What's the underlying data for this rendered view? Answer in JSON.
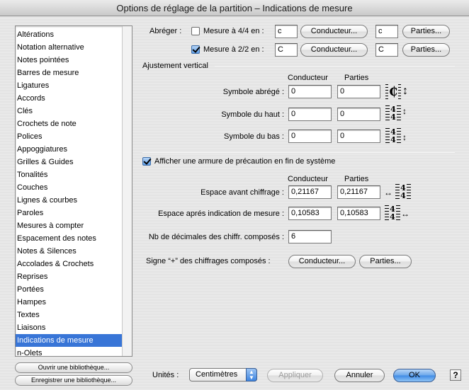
{
  "window": {
    "title": "Options de réglage de la partition – Indications de mesure"
  },
  "sidebar": {
    "items": [
      "Altérations",
      "Notation alternative",
      "Notes pointées",
      "Barres de mesure",
      "Ligatures",
      "Accords",
      "Clés",
      "Crochets de note",
      "Polices",
      "Appoggiatures",
      "Grilles & Guides",
      "Tonalités",
      "Couches",
      "Lignes & courbes",
      "Paroles",
      "Mesures à compter",
      "Espacement des notes",
      "Notes & Silences",
      "Accolades & Crochets",
      "Reprises",
      "Portées",
      "Hampes",
      "Textes",
      "Liaisons",
      "Indications de mesure",
      "n-Olets"
    ],
    "selected_index": 24,
    "open_library": "Ouvrir une bibliothèque...",
    "save_library": "Enregistrer une bibliothèque..."
  },
  "abbreviate": {
    "label": "Abréger :",
    "row44": {
      "checked": false,
      "label": "Mesure à 4/4 en :",
      "score_value": "c",
      "score_button": "Conducteur...",
      "parts_value": "c",
      "parts_button": "Parties..."
    },
    "row22": {
      "checked": true,
      "label": "Mesure à 2/2 en :",
      "score_value": "C",
      "score_button": "Conducteur...",
      "parts_value": "C",
      "parts_button": "Parties..."
    }
  },
  "vertical": {
    "title": "Ajustement vertical",
    "col_score": "Conducteur",
    "col_parts": "Parties",
    "rows": [
      {
        "label": "Symbole abrégé :",
        "score": "0",
        "parts": "0",
        "glyph": "C-bar"
      },
      {
        "label": "Symbole du haut :",
        "score": "0",
        "parts": "0",
        "glyph": "4/4"
      },
      {
        "label": "Symbole du bas :",
        "score": "0",
        "parts": "0",
        "glyph": "4/4"
      }
    ]
  },
  "courtesy": {
    "checked": true,
    "label": "Afficher une armure de précaution en fin de système",
    "col_score": "Conducteur",
    "col_parts": "Parties",
    "space_before": {
      "label": "Espace avant chiffrage :",
      "score": "0,21167",
      "parts": "0,21167"
    },
    "space_after": {
      "label": "Espace aprés indication de mesure :",
      "score": "0,10583",
      "parts": "0,10583"
    },
    "decimals": {
      "label": "Nb de décimales des chiffr. composés :",
      "value": "6"
    },
    "plus_sign": {
      "label": "Signe “+” des chiffrages composés :",
      "score_button": "Conducteur...",
      "parts_button": "Parties..."
    }
  },
  "footer": {
    "units_label": "Unités :",
    "units_value": "Centimètres",
    "apply": "Appliquer",
    "cancel": "Annuler",
    "ok": "OK",
    "help": "?"
  },
  "glyphs": {
    "arrow_vertical": "↕",
    "arrow_horizontal": "↔",
    "four": "4",
    "c_bar": "₵"
  }
}
